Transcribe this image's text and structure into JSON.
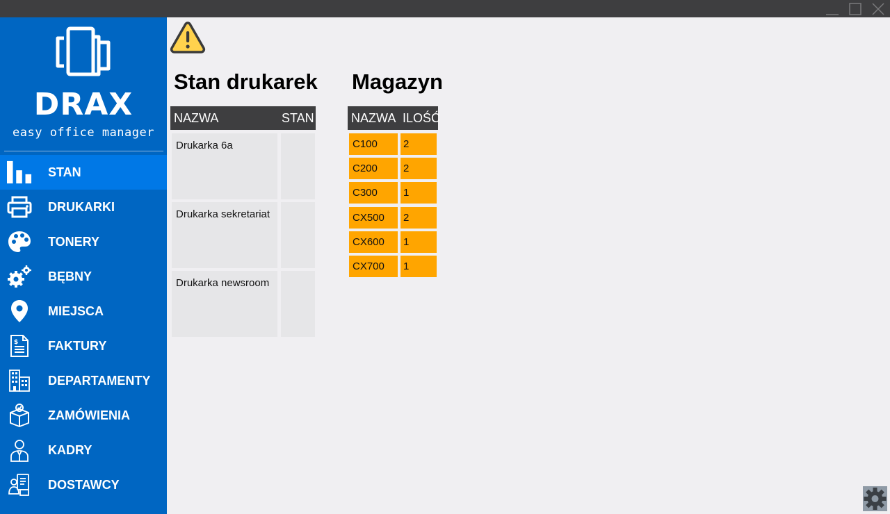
{
  "app": {
    "brand": "DRAX",
    "tagline": "easy office manager"
  },
  "colors": {
    "sidebar": "#0066c2",
    "sidebar_active": "#0078e6",
    "header_dark": "#3e3e40",
    "stock_cell": "#ffa500",
    "printer_cell": "#e6e6e8",
    "warning": "#ffd24d"
  },
  "nav": {
    "items": [
      {
        "label": "STAN",
        "icon": "bar-chart-icon",
        "active": true
      },
      {
        "label": "DRUKARKI",
        "icon": "printer-icon",
        "active": false
      },
      {
        "label": "TONERY",
        "icon": "palette-icon",
        "active": false
      },
      {
        "label": "BĘBNY",
        "icon": "gears-icon",
        "active": false
      },
      {
        "label": "MIEJSCA",
        "icon": "map-pin-icon",
        "active": false
      },
      {
        "label": "FAKTURY",
        "icon": "invoice-icon",
        "active": false
      },
      {
        "label": "DEPARTAMENTY",
        "icon": "building-icon",
        "active": false
      },
      {
        "label": "ZAMÓWIENIA",
        "icon": "package-icon",
        "active": false
      },
      {
        "label": "KADRY",
        "icon": "person-icon",
        "active": false
      },
      {
        "label": "DOSTAWCY",
        "icon": "supplier-icon",
        "active": false
      }
    ]
  },
  "printers": {
    "title": "Stan drukarek",
    "columns": [
      "NAZWA",
      "STAN"
    ],
    "rows": [
      {
        "name": "Drukarka 6a",
        "status": ""
      },
      {
        "name": "Drukarka sekretariat",
        "status": ""
      },
      {
        "name": "Drukarka newsroom",
        "status": ""
      }
    ]
  },
  "stock": {
    "title": "Magazyn",
    "columns": [
      "NAZWA",
      "ILOŚĆ"
    ],
    "rows": [
      {
        "name": "C100",
        "qty": "2"
      },
      {
        "name": "C200",
        "qty": "2"
      },
      {
        "name": "C300",
        "qty": "1"
      },
      {
        "name": "CX500",
        "qty": "2"
      },
      {
        "name": "CX600",
        "qty": "1"
      },
      {
        "name": "CX700",
        "qty": "1"
      }
    ]
  },
  "icons": {
    "warning": "warning-icon",
    "settings": "gear-icon"
  }
}
